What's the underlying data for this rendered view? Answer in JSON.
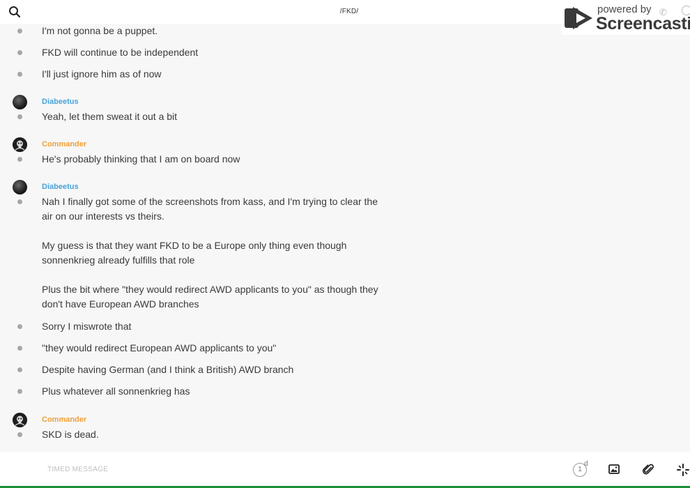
{
  "header": {
    "title": "/FKD/",
    "search_icon": "search-icon"
  },
  "watermark": {
    "line1": "powered by",
    "line2": "Screencastify"
  },
  "messages": [
    {
      "text": "I'm not gonna be a puppet."
    },
    {
      "text": "FKD will continue to be independent"
    },
    {
      "text": "I'll just ignore him as of now"
    },
    {
      "author": "Diabeetus",
      "author_color": "#4aa3d8",
      "text": "Yeah, let them sweat it out a bit"
    },
    {
      "author": "Commander",
      "author_color": "#f0a03a",
      "text": "He's probably thinking that I am on board now"
    },
    {
      "author": "Diabeetus",
      "author_color": "#4aa3d8",
      "lines": [
        "Nah I finally got some of the screenshots from kass, and I'm trying to clear the",
        "air on our interests vs theirs.",
        "My guess is that they want FKD to be a Europe only thing even though",
        "sonnenkrieg already fulfills that role",
        "Plus the bit where \"they would redirect AWD applicants to you\" as though they",
        "don't have European AWD branches"
      ]
    },
    {
      "text": "Sorry I miswrote that"
    },
    {
      "text": "\"they would redirect European AWD applicants to you\""
    },
    {
      "text": "Despite having German (and I think a British) AWD branch"
    },
    {
      "text": "Plus whatever all sonnenkrieg has"
    },
    {
      "author": "Commander",
      "author_color": "#f0a03a",
      "text": "SKD is dead."
    }
  ],
  "composer": {
    "placeholder": "TIMED MESSAGE",
    "timer_value": "1",
    "timer_unit": "d",
    "icons": [
      "image-icon",
      "paperclip-icon",
      "sparkle-icon"
    ]
  },
  "colors": {
    "author_blue": "#4aa3d8",
    "author_orange": "#f0a03a",
    "background": "#f7f7f8",
    "bullet": "#a7a7a7"
  }
}
